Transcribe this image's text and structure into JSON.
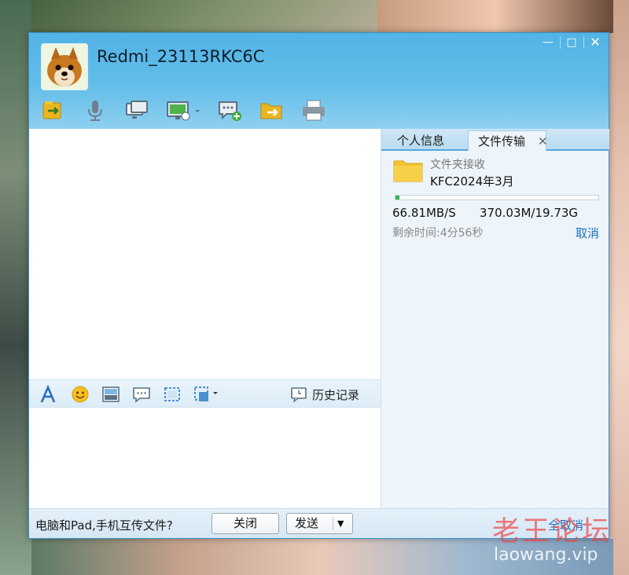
{
  "window": {
    "contact_name": "Redmi_23113RKC6C",
    "controls": {
      "minimize": "—",
      "maximize": "□",
      "close": "✕"
    }
  },
  "toolbar": {
    "icons": [
      "file-send-icon",
      "microphone-icon",
      "screen-share-icon",
      "remote-desktop-icon",
      "group-chat-add-icon",
      "folder-send-icon",
      "printer-icon"
    ]
  },
  "input_toolbar": {
    "icons": [
      "font-icon",
      "emoji-icon",
      "image-icon",
      "quick-reply-icon",
      "screenshot-icon",
      "more-icon"
    ],
    "history_label": "历史记录"
  },
  "right_panel": {
    "tabs": [
      "个人信息",
      "文件传输"
    ],
    "active_tab": "文件传输",
    "transfer": {
      "kind": "文件夹接收",
      "name": "KFC2024年3月",
      "progress": 0.018,
      "speed": "66.81MB/S",
      "size": "370.03M/19.73G",
      "remaining": "剩余时间:4分56秒",
      "cancel_label": "取消"
    }
  },
  "footer": {
    "hint": "电脑和Pad,手机互传文件?",
    "close_label": "关闭",
    "send_label": "发送",
    "cancel_all_label": "全取消"
  },
  "watermark": {
    "title": "老王论坛",
    "url": "laowang.vip"
  },
  "colors": {
    "header": "#5ab6e7",
    "progress": "#33b24a",
    "link": "#1a6fc2"
  }
}
